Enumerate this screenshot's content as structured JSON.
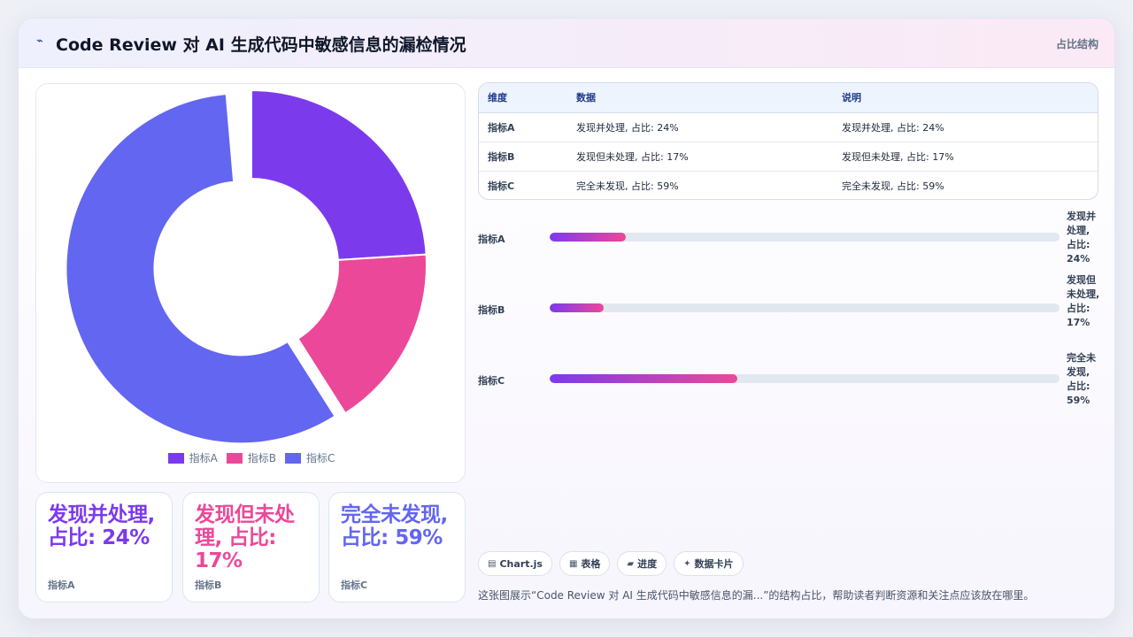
{
  "header": {
    "logo_icon": "sparkline-icon",
    "logo_glyph": "⌁",
    "title": "Code Review 对 AI 生成代码中敏感信息的漏检情况",
    "tag": "占比结构"
  },
  "colors": {
    "a": "#7c3aed",
    "b": "#ec4899",
    "c": "#6366f1"
  },
  "chart_data": {
    "type": "pie",
    "variant": "doughnut",
    "categories": [
      "指标A",
      "指标B",
      "指标C"
    ],
    "values": [
      24,
      17,
      59
    ],
    "unit": "%",
    "colors": [
      "#7c3aed",
      "#ec4899",
      "#6366f1"
    ],
    "legend_position": "bottom",
    "exploded_gap_between": [
      "指标C",
      "指标A"
    ]
  },
  "legend": [
    {
      "label": "指标A"
    },
    {
      "label": "指标B"
    },
    {
      "label": "指标C"
    }
  ],
  "kpis": [
    {
      "value": "发现并处理, 占比: 24%",
      "label": "指标A",
      "color": "#7c3aed"
    },
    {
      "value": "发现但未处理, 占比: 17%",
      "label": "指标B",
      "color": "#ec4899"
    },
    {
      "value": "完全未发现, 占比: 59%",
      "label": "指标C",
      "color": "#6366f1"
    }
  ],
  "table": {
    "headers": [
      "维度",
      "数据",
      "说明"
    ],
    "rows": [
      [
        "指标A",
        "发现并处理, 占比: 24%",
        "发现并处理, 占比: 24%"
      ],
      [
        "指标B",
        "发现但未处理, 占比: 17%",
        "发现但未处理, 占比: 17%"
      ],
      [
        "指标C",
        "完全未发现, 占比: 59%",
        "完全未发现, 占比: 59%"
      ]
    ]
  },
  "progress": [
    {
      "label": "指标A",
      "value_text": "发现并处理, 占比: 24%",
      "fraction": 0.15
    },
    {
      "label": "指标B",
      "value_text": "发现但未处理, 占比: 17%",
      "fraction": 0.106
    },
    {
      "label": "指标C",
      "value_text": "完全未发现, 占比: 59%",
      "fraction": 0.368
    }
  ],
  "chips": [
    {
      "icon": "chart-icon",
      "glyph": "▤",
      "label": "Chart.js"
    },
    {
      "icon": "table-icon",
      "glyph": "▦",
      "label": "表格"
    },
    {
      "icon": "progress-icon",
      "glyph": "▰",
      "label": "进度"
    },
    {
      "icon": "sparkle-icon",
      "glyph": "✦",
      "label": "数据卡片"
    }
  ],
  "caption": "这张图展示“Code Review 对 AI 生成代码中敏感信息的漏...”的结构占比，帮助读者判断资源和关注点应该放在哪里。"
}
